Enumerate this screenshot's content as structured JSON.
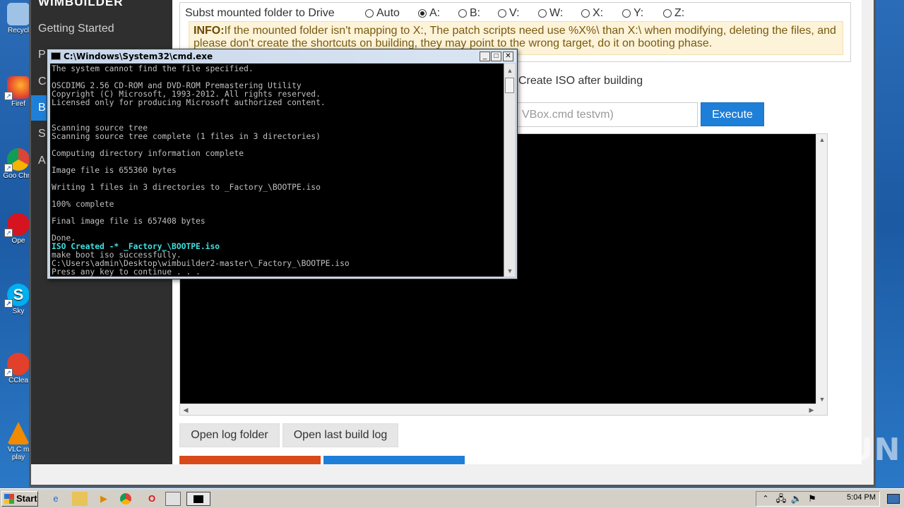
{
  "desktop": {
    "icons": [
      "Recycl",
      "Firef",
      "Goo Chro",
      "Ope",
      "Sky",
      "CClea",
      "VLC m play"
    ]
  },
  "app": {
    "brand": "WIMBUILDER",
    "nav": [
      "Getting Started",
      "P",
      "C",
      "B",
      "S",
      "A"
    ],
    "subst_label": "Subst mounted folder to Drive",
    "drives": [
      "Auto",
      "A:",
      "B:",
      "V:",
      "W:",
      "X:",
      "Y:",
      "Z:"
    ],
    "selected_drive": "A:",
    "info_title": "INFO:",
    "info_text": "If the mounted folder isn't mapping to X:, The patch scripts need use %X%\\ than X:\\ when modifying, deleting the files, and please don't create the shortcuts on building, they may point to the wrong target, do it on booting phase.",
    "create_iso_label": "Create ISO after building",
    "command_placeholder": "VBox.cmd testvm)",
    "execute_label": "Execute",
    "open_log_folder": "Open log folder",
    "open_last_build_log": "Open last build log"
  },
  "cmd": {
    "title": "C:\\Windows\\System32\\cmd.exe",
    "lines": [
      "The system cannot find the file specified.",
      "",
      "OSCDIMG 2.56 CD-ROM and DVD-ROM Premastering Utility",
      "Copyright (C) Microsoft, 1993-2012. All rights reserved.",
      "Licensed only for producing Microsoft authorized content.",
      "",
      "",
      "Scanning source tree",
      "Scanning source tree complete (1 files in 3 directories)",
      "",
      "Computing directory information complete",
      "",
      "Image file is 655360 bytes",
      "",
      "Writing 1 files in 3 directories to _Factory_\\BOOTPE.iso",
      "",
      "100% complete",
      "",
      "Final image file is 657408 bytes",
      "",
      "Done."
    ],
    "highlight_line": "ISO Created -* _Factory_\\BOOTPE.iso",
    "tail_lines": [
      "make boot iso successfully.",
      "C:\\Users\\admin\\Desktop\\wimbuilder2-master\\_Factory_\\BOOTPE.iso",
      "Press any key to continue . . ."
    ]
  },
  "taskbar": {
    "start_label": "Start",
    "clock": "5:04 PM"
  },
  "watermark": "ANY RUN"
}
